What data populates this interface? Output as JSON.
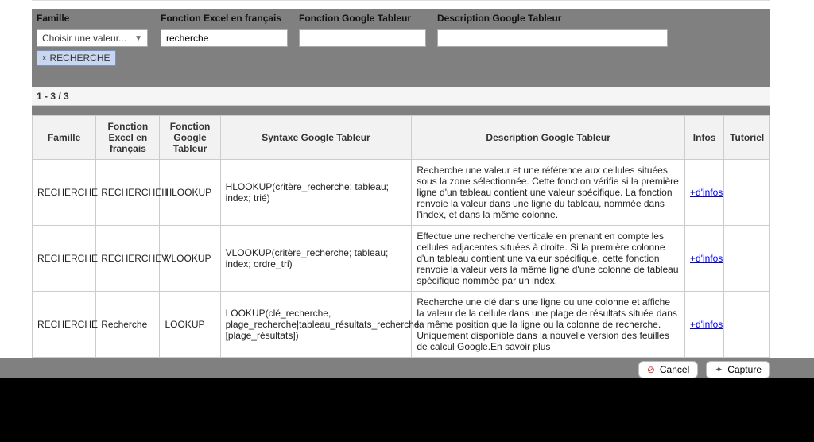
{
  "filters": {
    "famille": {
      "label": "Famille",
      "selectPlaceholder": "Choisir une valeur..."
    },
    "fonctionExcel": {
      "label": "Fonction Excel en français",
      "value": "recherche"
    },
    "fonctionGoogle": {
      "label": "Fonction Google Tableur",
      "value": ""
    },
    "descGoogle": {
      "label": "Description Google Tableur",
      "value": ""
    },
    "chip": {
      "x": "x",
      "label": "RECHERCHE"
    }
  },
  "countText": "1 - 3 / 3",
  "headers": {
    "famille": "Famille",
    "excel": "Fonction Excel en français",
    "google": "Fonction Google Tableur",
    "syntax": "Syntaxe Google Tableur",
    "desc": "Description Google Tableur",
    "infos": "Infos",
    "tuto": "Tutoriel"
  },
  "rows": [
    {
      "famille": "RECHERCHE",
      "excel": "RECHERCHEH",
      "google": "HLOOKUP",
      "syntax": "HLOOKUP(critère_recherche; tableau; index; trié)",
      "desc": "Recherche une valeur et une référence aux cellules situées sous la zone sélectionnée. Cette fonction vérifie si la première ligne d'un tableau contient une valeur spécifique. La fonction renvoie la valeur dans une ligne du tableau, nommée dans l'index, et dans la même colonne.",
      "infos": "+d'infos",
      "tuto": ""
    },
    {
      "famille": "RECHERCHE",
      "excel": "RECHERCHEV",
      "google": "VLOOKUP",
      "syntax": "VLOOKUP(critère_recherche; tableau; index; ordre_tri)",
      "desc": "Effectue une recherche verticale en prenant en compte les cellules adjacentes situées à droite. Si la première colonne d'un tableau contient une valeur spécifique, cette fonction renvoie la valeur vers la même ligne d'une colonne de tableau spécifique nommée par un index.",
      "infos": "+d'infos",
      "tuto": ""
    },
    {
      "famille": "RECHERCHE",
      "excel": "Recherche",
      "google": "LOOKUP",
      "syntax": "LOOKUP(clé_recherche, plage_recherche|tableau_résultats_recherche, [plage_résultats])",
      "desc": "Recherche une clé dans une ligne ou une colonne et affiche la valeur de la cellule dans une plage de résultats située dans la même position que la ligne ou la colonne de recherche. Uniquement disponible dans la nouvelle version des feuilles de calcul Google.En savoir plus",
      "infos": "+d'infos",
      "tuto": ""
    }
  ],
  "buttons": {
    "cancel": "Cancel",
    "capture": "Capture"
  }
}
